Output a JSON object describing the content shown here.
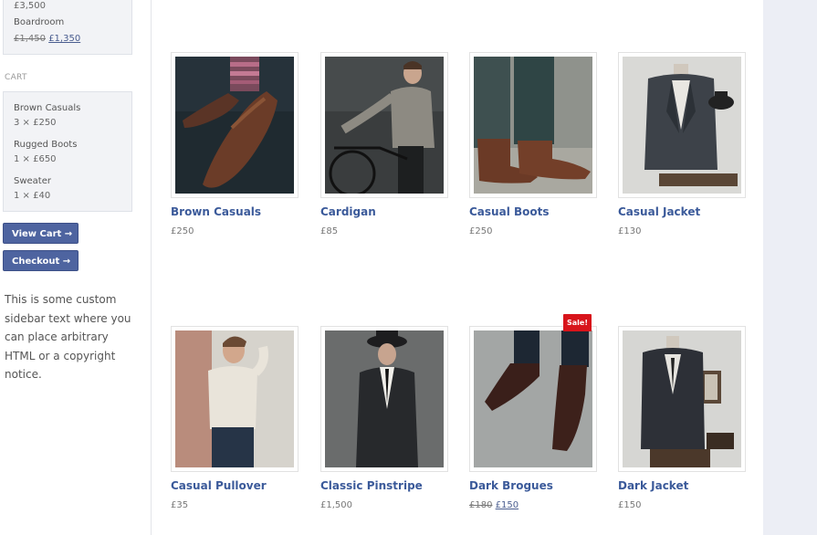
{
  "sidebar": {
    "recent": [
      {
        "price": "£3,500"
      },
      {
        "name": "Boardroom",
        "old_price": "£1,450",
        "new_price": "£1,350"
      }
    ],
    "cart_heading": "CART",
    "cart_items": [
      {
        "name": "Brown Casuals",
        "qty_price": "3 × £250"
      },
      {
        "name": "Rugged Boots",
        "qty_price": "1 × £650"
      },
      {
        "name": "Sweater",
        "qty_price": "1 × £40"
      }
    ],
    "view_cart_label": "View Cart →",
    "checkout_label": "Checkout →",
    "custom_text": "This is some custom sidebar text where you can place arbitrary HTML or a copyright notice."
  },
  "products": [
    {
      "name": "Brown Casuals",
      "price": "£250",
      "image": "brown-shoes-photo"
    },
    {
      "name": "Cardigan",
      "price": "£85",
      "image": "man-on-bicycle-photo"
    },
    {
      "name": "Casual Boots",
      "price": "£250",
      "image": "brown-boots-photo"
    },
    {
      "name": "Casual Jacket",
      "price": "£130",
      "image": "jacket-on-mannequin-photo"
    },
    {
      "name": "Casual Pullover",
      "price": "£35",
      "image": "man-in-pullover-photo"
    },
    {
      "name": "Classic Pinstripe",
      "price": "£1,500",
      "image": "man-in-suit-photo"
    },
    {
      "name": "Dark Brogues",
      "old_price": "£180",
      "new_price": "£150",
      "badge": "Sale!",
      "image": "dark-brogues-photo"
    },
    {
      "name": "Dark Jacket",
      "price": "£150",
      "image": "dark-jacket-mannequin-photo"
    }
  ],
  "colors": {
    "link": "#3b5a9a",
    "button": "#4e64a0",
    "sale_badge": "#d8141b",
    "panel": "#eceef5"
  }
}
